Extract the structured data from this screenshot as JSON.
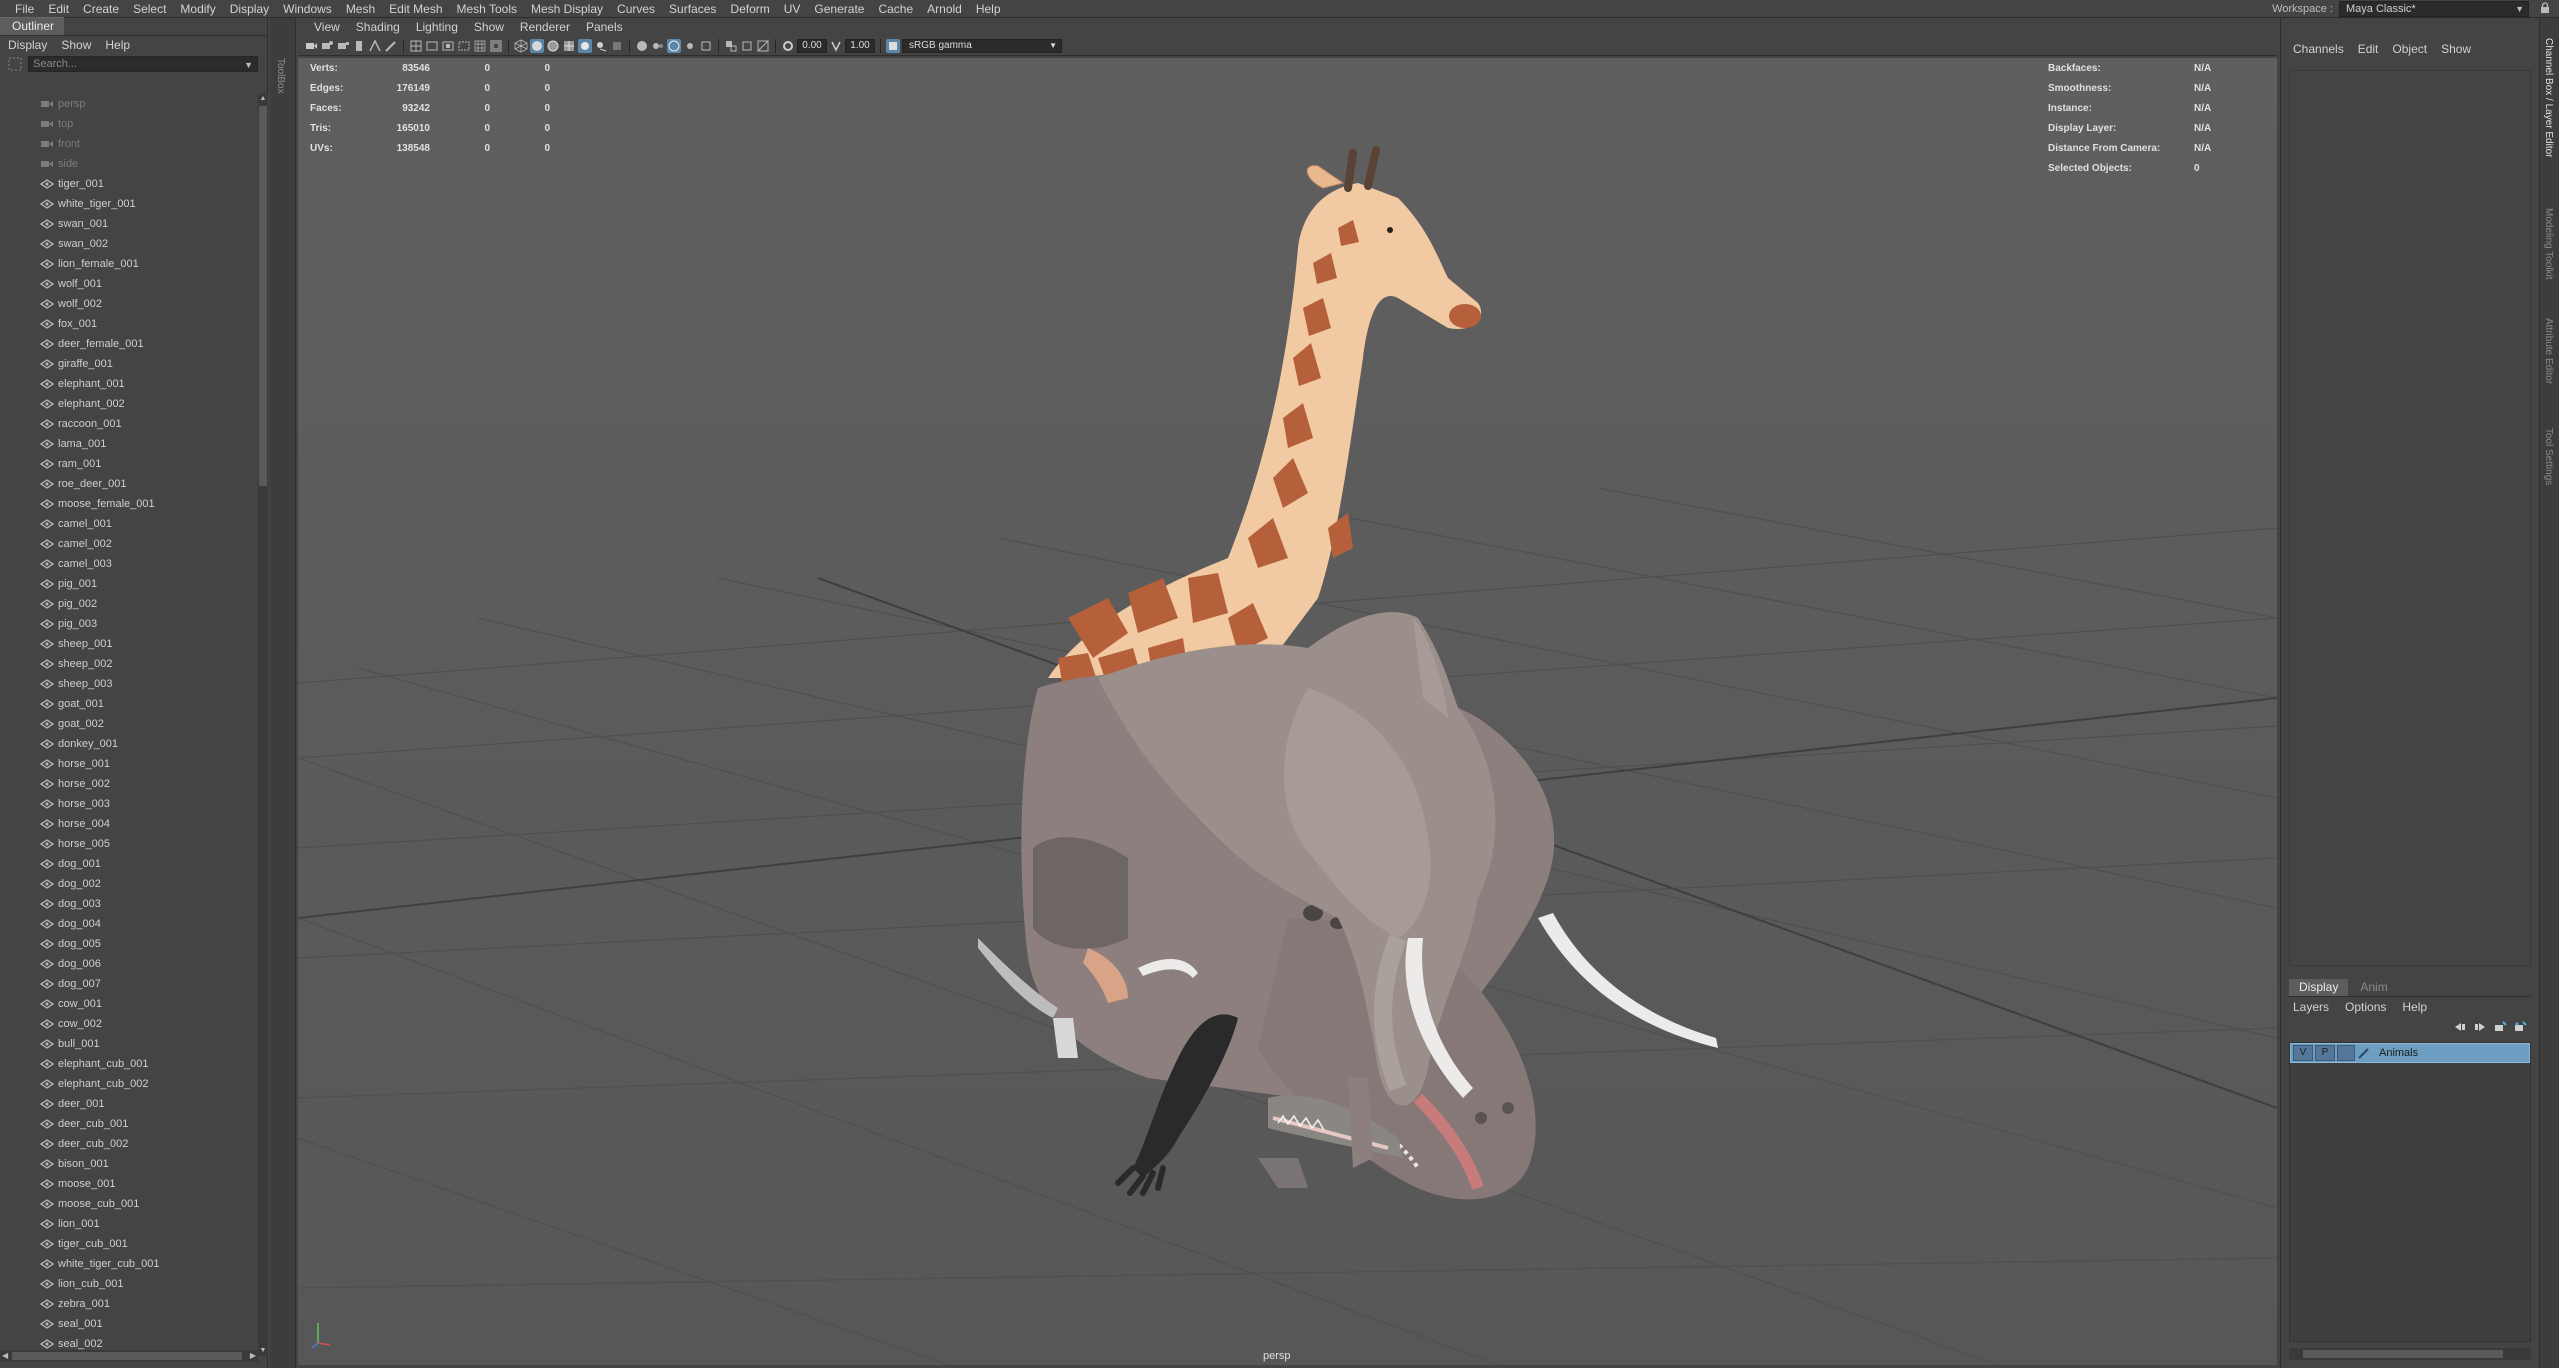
{
  "menubar": {
    "items": [
      "File",
      "Edit",
      "Create",
      "Select",
      "Modify",
      "Display",
      "Windows",
      "Mesh",
      "Edit Mesh",
      "Mesh Tools",
      "Mesh Display",
      "Curves",
      "Surfaces",
      "Deform",
      "UV",
      "Generate",
      "Cache",
      "Arnold",
      "Help"
    ],
    "workspace_label": "Workspace :",
    "workspace_value": "Maya Classic*"
  },
  "outliner": {
    "tab": "Outliner",
    "menus": [
      "Display",
      "Show",
      "Help"
    ],
    "search_placeholder": "Search...",
    "cameras": [
      "persp",
      "top",
      "front",
      "side"
    ],
    "items": [
      "tiger_001",
      "white_tiger_001",
      "swan_001",
      "swan_002",
      "lion_female_001",
      "wolf_001",
      "wolf_002",
      "fox_001",
      "deer_female_001",
      "giraffe_001",
      "elephant_001",
      "elephant_002",
      "raccoon_001",
      "lama_001",
      "ram_001",
      "roe_deer_001",
      "moose_female_001",
      "camel_001",
      "camel_002",
      "camel_003",
      "pig_001",
      "pig_002",
      "pig_003",
      "sheep_001",
      "sheep_002",
      "sheep_003",
      "goat_001",
      "goat_002",
      "donkey_001",
      "horse_001",
      "horse_002",
      "horse_003",
      "horse_004",
      "horse_005",
      "dog_001",
      "dog_002",
      "dog_003",
      "dog_004",
      "dog_005",
      "dog_006",
      "dog_007",
      "cow_001",
      "cow_002",
      "bull_001",
      "elephant_cub_001",
      "elephant_cub_002",
      "deer_001",
      "deer_cub_001",
      "deer_cub_002",
      "bison_001",
      "moose_001",
      "moose_cub_001",
      "lion_001",
      "tiger_cub_001",
      "white_tiger_cub_001",
      "lion_cub_001",
      "zebra_001",
      "seal_001",
      "seal_002"
    ]
  },
  "gutter_label": "ToolBox",
  "viewport": {
    "menus": [
      "View",
      "Shading",
      "Lighting",
      "Show",
      "Renderer",
      "Panels"
    ],
    "exposure": "0.00",
    "gamma": "1.00",
    "color_space": "sRGB gamma",
    "camera": "persp",
    "hud_left": [
      {
        "label": "Verts:",
        "value": "83546",
        "a": "0",
        "b": "0"
      },
      {
        "label": "Edges:",
        "value": "176149",
        "a": "0",
        "b": "0"
      },
      {
        "label": "Faces:",
        "value": "93242",
        "a": "0",
        "b": "0"
      },
      {
        "label": "Tris:",
        "value": "165010",
        "a": "0",
        "b": "0"
      },
      {
        "label": "UVs:",
        "value": "138548",
        "a": "0",
        "b": "0"
      }
    ],
    "hud_right": [
      {
        "label": "Backfaces:",
        "value": "N/A"
      },
      {
        "label": "Smoothness:",
        "value": "N/A"
      },
      {
        "label": "Instance:",
        "value": "N/A"
      },
      {
        "label": "Display Layer:",
        "value": "N/A"
      },
      {
        "label": "Distance From Camera:",
        "value": "N/A"
      },
      {
        "label": "Selected Objects:",
        "value": "0"
      }
    ]
  },
  "channelbox": {
    "menus": [
      "Channels",
      "Edit",
      "Object",
      "Show"
    ]
  },
  "layer_editor": {
    "tabs": [
      "Display",
      "Anim"
    ],
    "menus": [
      "Layers",
      "Options",
      "Help"
    ],
    "layer": {
      "v": "V",
      "p": "P",
      "name": "Animals"
    }
  },
  "side_tabs": [
    "Channel Box / Layer Editor",
    "Modeling Toolkit",
    "Attribute Editor",
    "Tool Settings"
  ],
  "colors": {
    "accent": "#5b86a8",
    "layer_highlight": "#6d9ec2",
    "giraffe_patch": "#b5603a",
    "giraffe_base": "#f1c9a2",
    "hippo": "#8c7f7e"
  }
}
